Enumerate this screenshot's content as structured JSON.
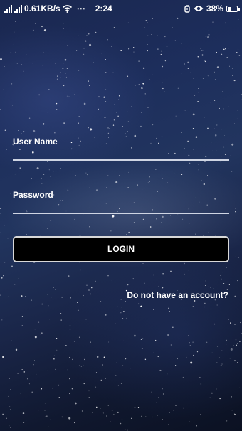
{
  "status_bar": {
    "network_speed": "0.61KB/s",
    "dots": "⋯",
    "time": "2:24",
    "battery_percent": "38%",
    "battery_level": 0.38,
    "icons": [
      "signal-icon",
      "signal-icon",
      "wifi-icon",
      "alarm-icon",
      "eye-icon",
      "battery-icon"
    ]
  },
  "form": {
    "username_label": "User Name",
    "username_value": "",
    "password_label": "Password",
    "password_value": "",
    "login_label": "LOGIN",
    "signup_link": "Do not have an account?"
  },
  "colors": {
    "background_top": "#1d2e5c",
    "background_bottom": "#0b1122",
    "button_bg": "#000000",
    "button_border": "#d8d8d8",
    "text": "#ffffff"
  }
}
